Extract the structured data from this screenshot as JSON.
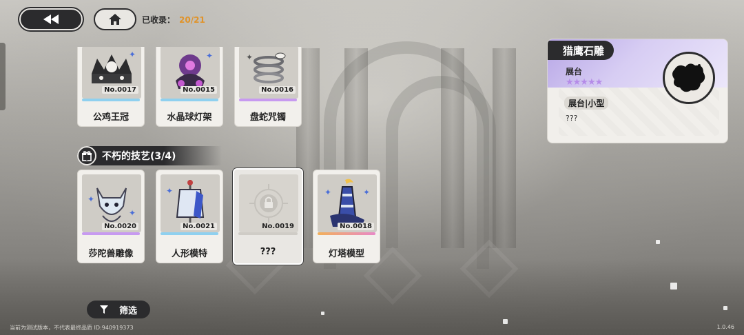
{
  "header": {
    "collected_label": "已收录：",
    "collected_value": "20/21"
  },
  "top_row_cards": [
    {
      "no": "No.0017",
      "name": "公鸡王冠",
      "rarity_color": "#8fd0ef",
      "icon": "rooster-crown-icon"
    },
    {
      "no": "No.0015",
      "name": "水晶球灯架",
      "rarity_color": "#8fd0ef",
      "icon": "crystal-ball-lamp-icon"
    },
    {
      "no": "No.0016",
      "name": "盘蛇咒镯",
      "rarity_color": "#c79af0",
      "icon": "serpent-bracelet-icon"
    }
  ],
  "section": {
    "title": "不朽的技艺(3/4)",
    "icon": "gift-icon"
  },
  "second_row_cards": [
    {
      "no": "No.0020",
      "name": "莎陀兽雕像",
      "rarity_color": "#c79af0",
      "icon": "beast-statue-icon"
    },
    {
      "no": "No.0021",
      "name": "人形模特",
      "rarity_color": "#8fd0ef",
      "icon": "mannequin-icon"
    },
    {
      "no": "No.0019",
      "name": "???",
      "rarity_color": "#cfccc6",
      "icon": "lock-icon"
    },
    {
      "no": "No.0018",
      "name": "灯塔模型",
      "rarity_color": "#f2b05a",
      "icon": "lighthouse-model-icon"
    }
  ],
  "detail": {
    "title": "猎鹰石雕",
    "category": "展台",
    "stars": "★★★★★",
    "tag": "展台|小型",
    "description": "???",
    "accent_color": "#b7a6e6"
  },
  "filter": {
    "label": "筛选",
    "icon": "filter-icon"
  },
  "footer": {
    "left": "当前为测试版本，不代表最终品质 ID:940919373",
    "right": "1.0.46"
  }
}
